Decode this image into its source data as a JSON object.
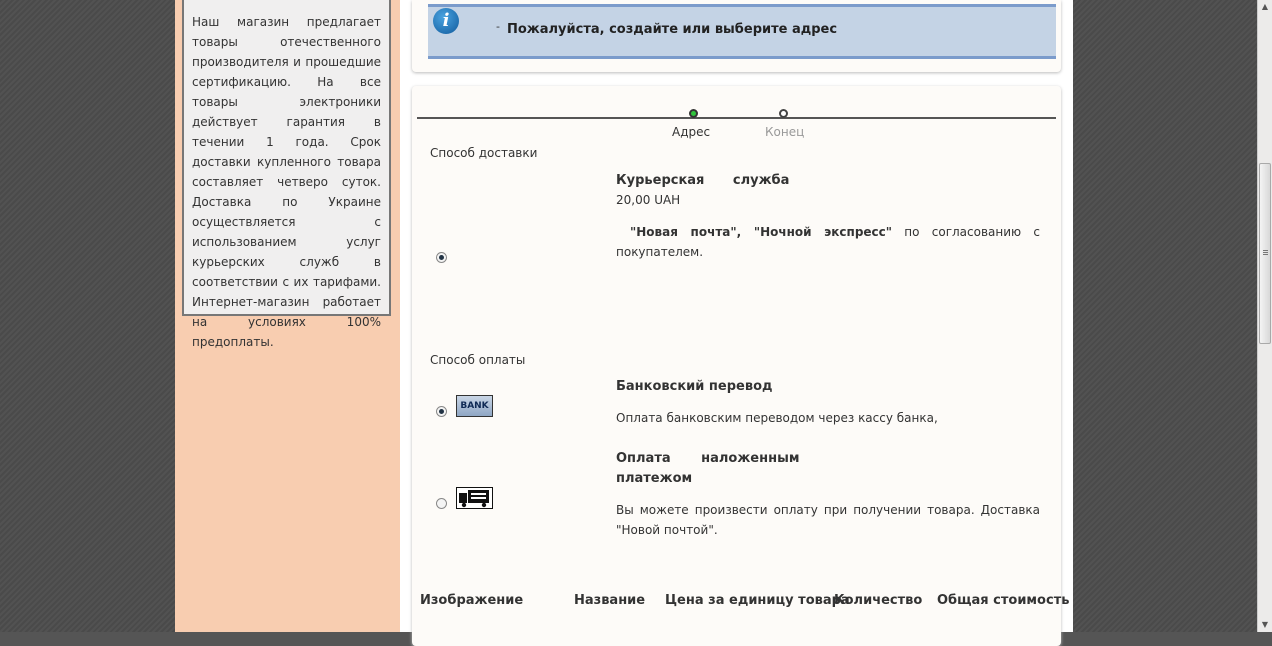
{
  "sidebar": {
    "info_text": "Наш магазин предлагает товары отечественного производителя и прошедшие сертификацию. На все товары электроники действует гарантия в течении 1 года. Срок доставки купленного товара составляет четверо суток. Доставка по Украине осуществляется с использованием услуг курьерских служб в соответствии с их тарифами. Интернет-магазин работает на условиях 100% предоплаты."
  },
  "notice": {
    "dash": "-",
    "text": "Пожалуйста, создайте или выберите адрес"
  },
  "steps": [
    {
      "label": "Адрес",
      "status": "active"
    },
    {
      "label": "Конец",
      "status": "inactive"
    }
  ],
  "shipping": {
    "heading": "Способ доставки",
    "method_name": "Курьерская служба",
    "price": "20,00",
    "currency": "UAH",
    "desc_bold": "\"Новая почта\", \"Ночной экспресс\"",
    "desc_rest": " по согласованию с покупателем.",
    "selected": true
  },
  "payment": {
    "heading": "Способ оплаты",
    "options": [
      {
        "name": "Банковский перевод",
        "icon_text": "BANK",
        "desc": "Оплата банковским переводом через кассу банка,",
        "selected": true
      },
      {
        "name_line1": "Оплата наложенным",
        "name_line2": "платежом",
        "desc": "Вы можете произвести оплату при получении товара. Доставка \"Новой почтой\".",
        "selected": false
      }
    ]
  },
  "table": {
    "headers": [
      "Изображение",
      "Название",
      "Цена за единицу товара",
      "Количество",
      "Общая стоимость"
    ]
  },
  "colors": {
    "sidebar_bg": "#f8cdb0",
    "notice_bg": "#c4d3e5",
    "active_step": "#2fc43c"
  }
}
